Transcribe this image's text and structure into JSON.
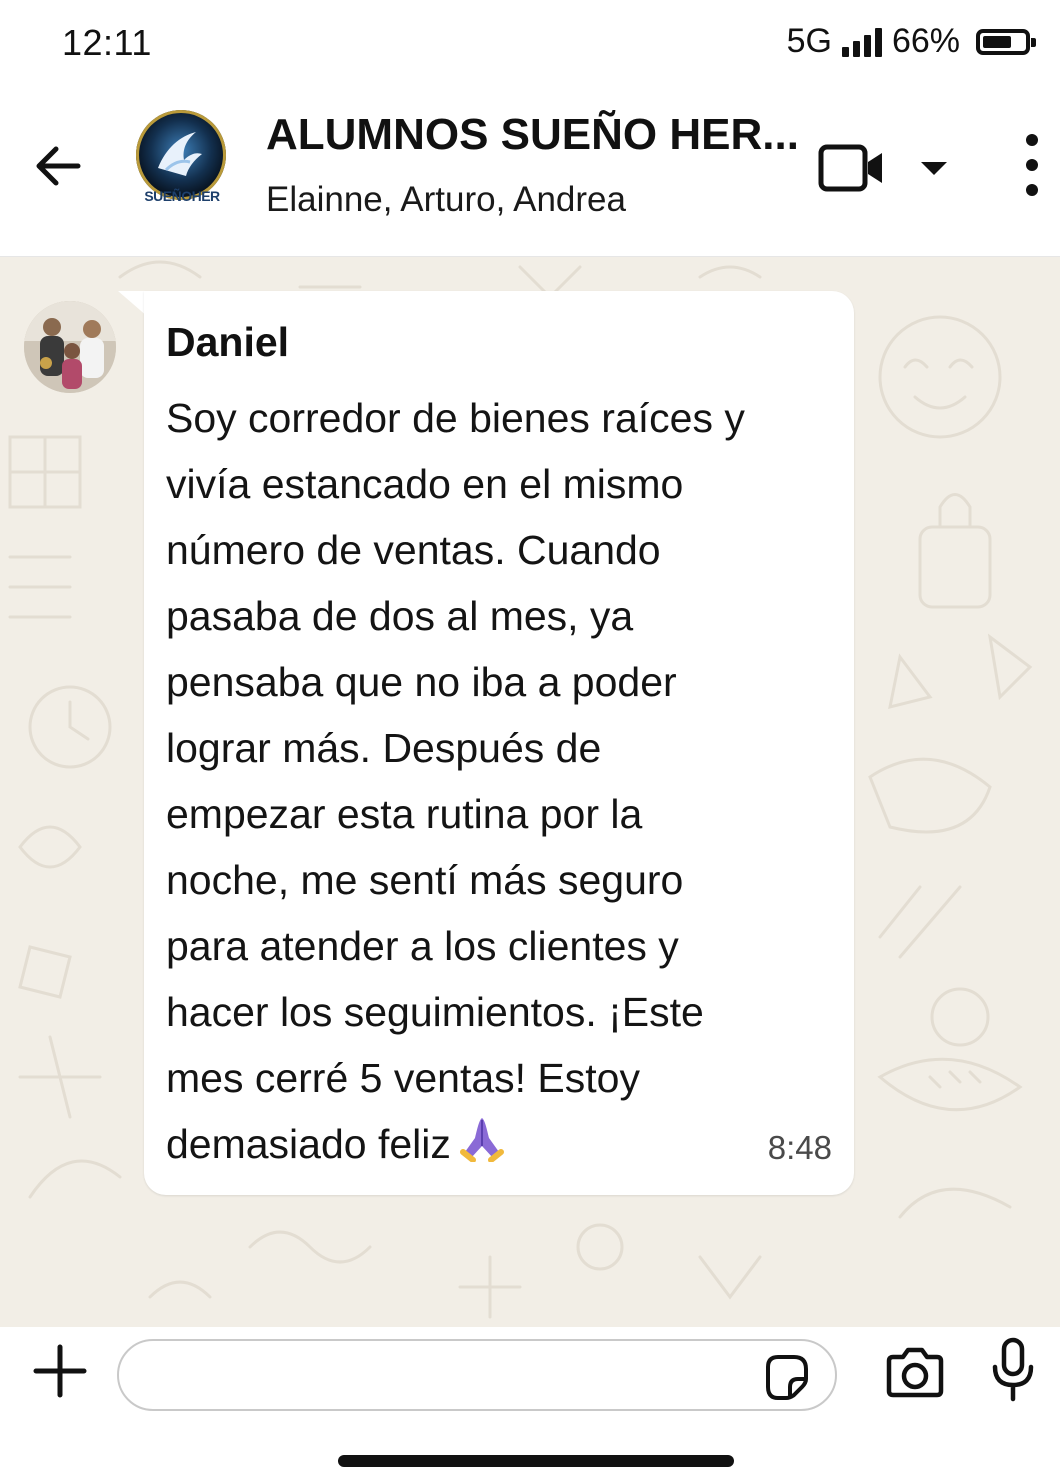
{
  "status_bar": {
    "time": "12:11",
    "network": "5G",
    "battery": "66%",
    "battery_level": 0.66,
    "signal_bars": 4
  },
  "header": {
    "back_icon": "arrow-left-icon",
    "group_avatar_caption": "SUEÑOHER",
    "title": "ALUMNOS SUEÑO HER...",
    "members": "Elainne, Arturo, Andrea",
    "video_icon": "video-camera-icon",
    "dropdown_icon": "caret-down-icon",
    "menu_icon": "vertical-dots-icon"
  },
  "chat": {
    "background_color": "#f2eee6",
    "messages": [
      {
        "sender": "Daniel",
        "text": " Soy corredor de bienes raíces y\nvivía estancado en el mismo\nnúmero de ventas. Cuando\npasaba de dos al mes, ya\npensaba que no iba a poder\nlograr más. Después de\nempezar esta rutina por la\nnoche, me sentí más seguro\npara atender a los clientes y\nhacer los seguimientos. ¡Este\nmes cerré 5 ventas! Estoy\ndemasiado feliz",
        "emoji": "folded-hands-emoji",
        "time": "8:48"
      }
    ]
  },
  "input_bar": {
    "plus_icon": "plus-icon",
    "message_value": "",
    "placeholder": "",
    "sticker_icon": "sticker-icon",
    "camera_icon": "camera-icon",
    "mic_icon": "microphone-icon"
  }
}
